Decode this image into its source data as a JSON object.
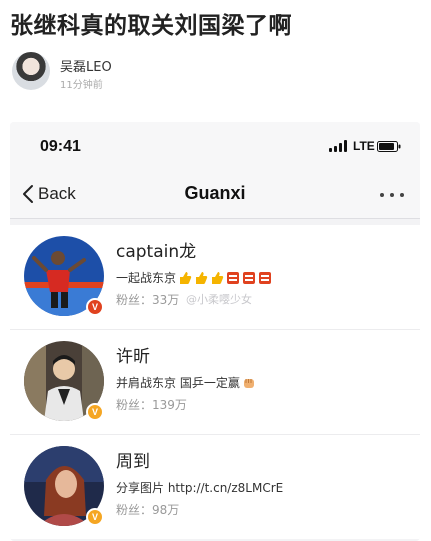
{
  "post": {
    "title": "张继科真的取关刘国梁了啊",
    "author": "吴磊LEO",
    "time": "11分钟前"
  },
  "phone": {
    "status_time": "09:41",
    "network": "LTE",
    "nav": {
      "back_label": "Back",
      "title": "Guanxi",
      "more_icon": "more-dots-icon"
    }
  },
  "users": [
    {
      "name": "captain龙",
      "bio": "一起战东京",
      "bio_emojis": [
        "thumbs-up",
        "thumbs-up",
        "thumbs-up",
        "cheer",
        "cheer",
        "cheer"
      ],
      "fans_label": "粉丝：",
      "fans": "33万",
      "watermark": "@小柔嘤少女",
      "verified_color": "#e0421f"
    },
    {
      "name": "许昕",
      "bio": "并肩战东京 国乒一定赢",
      "bio_emojis": [
        "fist"
      ],
      "fans_label": "粉丝：",
      "fans": "139万",
      "verified_color": "#f5a623"
    },
    {
      "name": "周到",
      "bio": "分享图片 http://t.cn/z8LMCrE",
      "bio_emojis": [],
      "fans_label": "粉丝：",
      "fans": "98万",
      "verified_color": "#f5a623"
    }
  ],
  "colors": {
    "background": "#ffffff",
    "phone_bg": "#f3f3f5",
    "verified_red": "#e0421f",
    "verified_gold": "#f5a623"
  }
}
